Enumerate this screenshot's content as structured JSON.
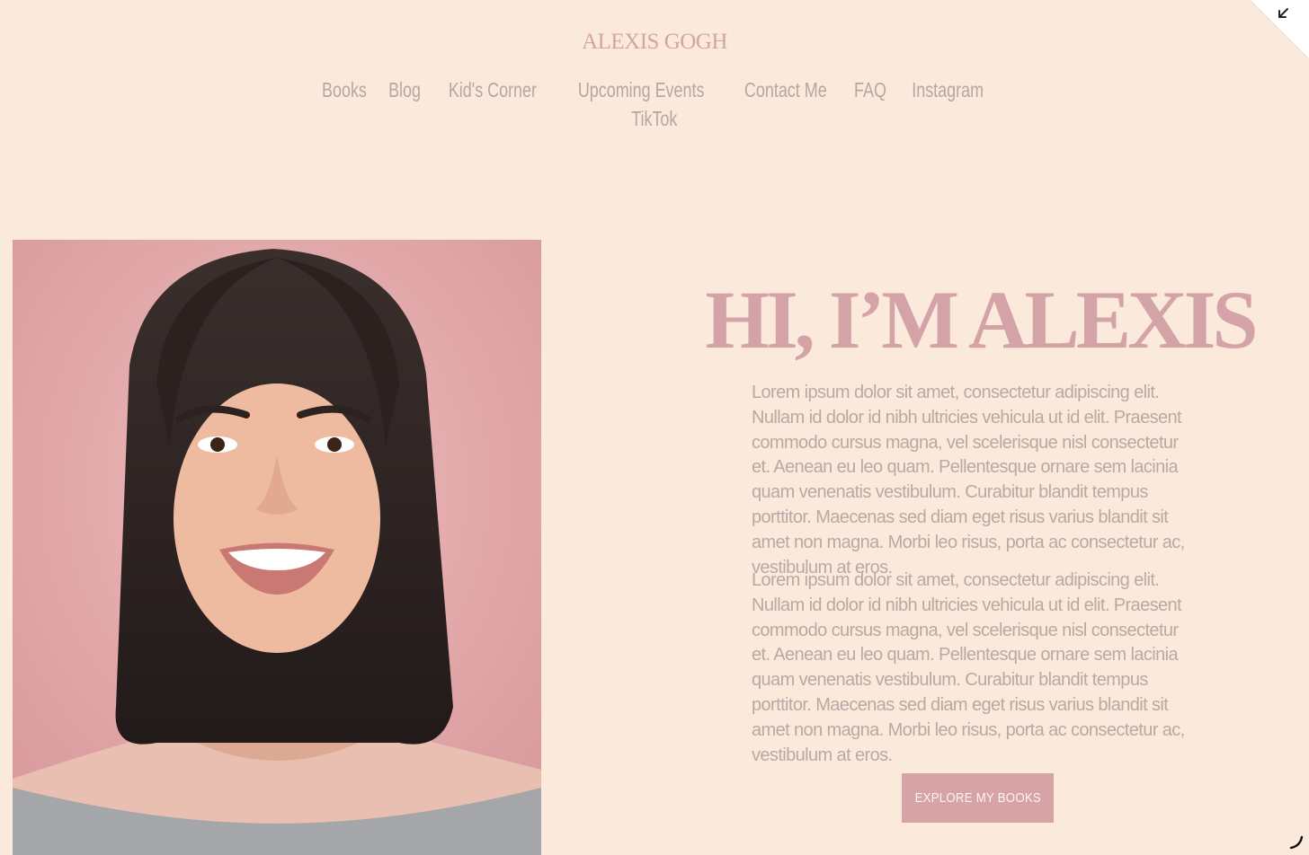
{
  "site": {
    "title": "ALEXIS GOGH"
  },
  "nav": {
    "items": [
      {
        "label": "Books"
      },
      {
        "label": "Blog"
      },
      {
        "label": "Kid's Corner"
      },
      {
        "label": "Upcoming Events"
      },
      {
        "label": "Contact Me"
      },
      {
        "label": "FAQ"
      },
      {
        "label": "Instagram"
      },
      {
        "label": "TikTok"
      }
    ]
  },
  "hero": {
    "heading": "HI, I’M ALEXIS",
    "paragraphs": [
      "Lorem ipsum dolor sit amet, consectetur adipiscing elit. Nullam id dolor id nibh ultricies vehicula ut id elit. Praesent commodo cursus magna, vel scelerisque nisl consectetur et. Aenean eu leo quam. Pellentesque ornare sem lacinia quam venenatis vestibulum. Curabitur blandit tempus porttitor. Maecenas sed diam eget risus varius blandit sit amet non magna. Morbi leo risus, porta ac consectetur ac, vestibulum at eros.",
      "Lorem ipsum dolor sit amet, consectetur adipiscing elit. Nullam id dolor id nibh ultricies vehicula ut id elit. Praesent commodo cursus magna, vel scelerisque nisl consectetur et. Aenean eu leo quam. Pellentesque ornare sem lacinia quam venenatis vestibulum. Curabitur blandit tempus porttitor. Maecenas sed diam eget risus varius blandit sit amet non magna. Morbi leo risus, porta ac consectetur ac, vestibulum at eros."
    ],
    "cta_label": "EXPLORE MY BOOKS"
  },
  "colors": {
    "background": "#fbeadc",
    "accent": "#d4a3a8",
    "text": "#bda6a4",
    "button": "#d6a3a6"
  },
  "icons": {
    "corner": "collapse-arrow-icon",
    "resize": "resize-handle-icon"
  }
}
